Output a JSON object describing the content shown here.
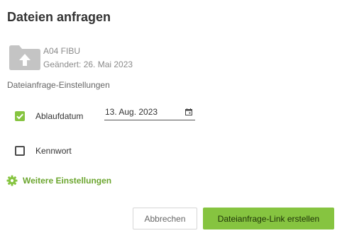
{
  "dialog": {
    "title": "Dateien anfragen"
  },
  "file": {
    "name": "A04 FIBU",
    "modified": "Geändert: 26. Mai 2023",
    "icon": "folder-upload-icon"
  },
  "settings": {
    "section_label": "Dateianfrage-Einstellungen",
    "expiry": {
      "label": "Ablaufdatum",
      "checked": true,
      "value": "13. Aug. 2023",
      "icon": "calendar-icon"
    },
    "password": {
      "label": "Kennwort",
      "checked": false
    },
    "more": {
      "label": "Weitere Einstellungen",
      "icon": "gear-icon"
    }
  },
  "buttons": {
    "cancel": "Abbrechen",
    "create": "Dateianfrage-Link erstellen"
  },
  "colors": {
    "accent": "#86c440",
    "accent_text": "#6ba52e"
  }
}
